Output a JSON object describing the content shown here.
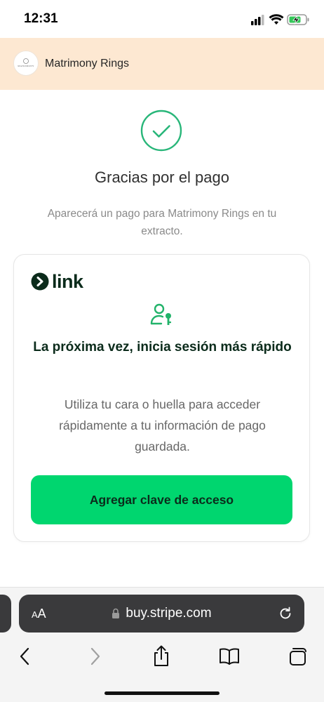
{
  "status_bar": {
    "time": "12:31"
  },
  "merchant": {
    "logo_text": "MATRIMONY",
    "name": "Matrimony Rings"
  },
  "success": {
    "title": "Gracias por el pago",
    "subtitle": "Aparecerá un pago para Matrimony Rings en tu extracto."
  },
  "link_card": {
    "brand": "link",
    "heading": "La próxima vez, inicia sesión más rápido",
    "body": "Utiliza tu cara o huella para acceder rápidamente a tu información de pago guardada.",
    "button_label": "Agregar clave de acceso"
  },
  "browser": {
    "aa_small": "A",
    "aa_large": "A",
    "url": "buy.stripe.com"
  },
  "colors": {
    "header_bg": "#fde8d2",
    "success_green": "#28b679",
    "link_green": "#00d66f",
    "link_dark": "#0b2b1b"
  },
  "icons": {
    "success": "checkmark-circle-icon",
    "user_key": "user-key-icon",
    "lock": "lock-icon",
    "reload": "reload-icon",
    "back": "chevron-left-icon",
    "forward": "chevron-right-icon",
    "share": "share-icon",
    "bookmarks": "book-icon",
    "tabs": "tabs-icon"
  }
}
